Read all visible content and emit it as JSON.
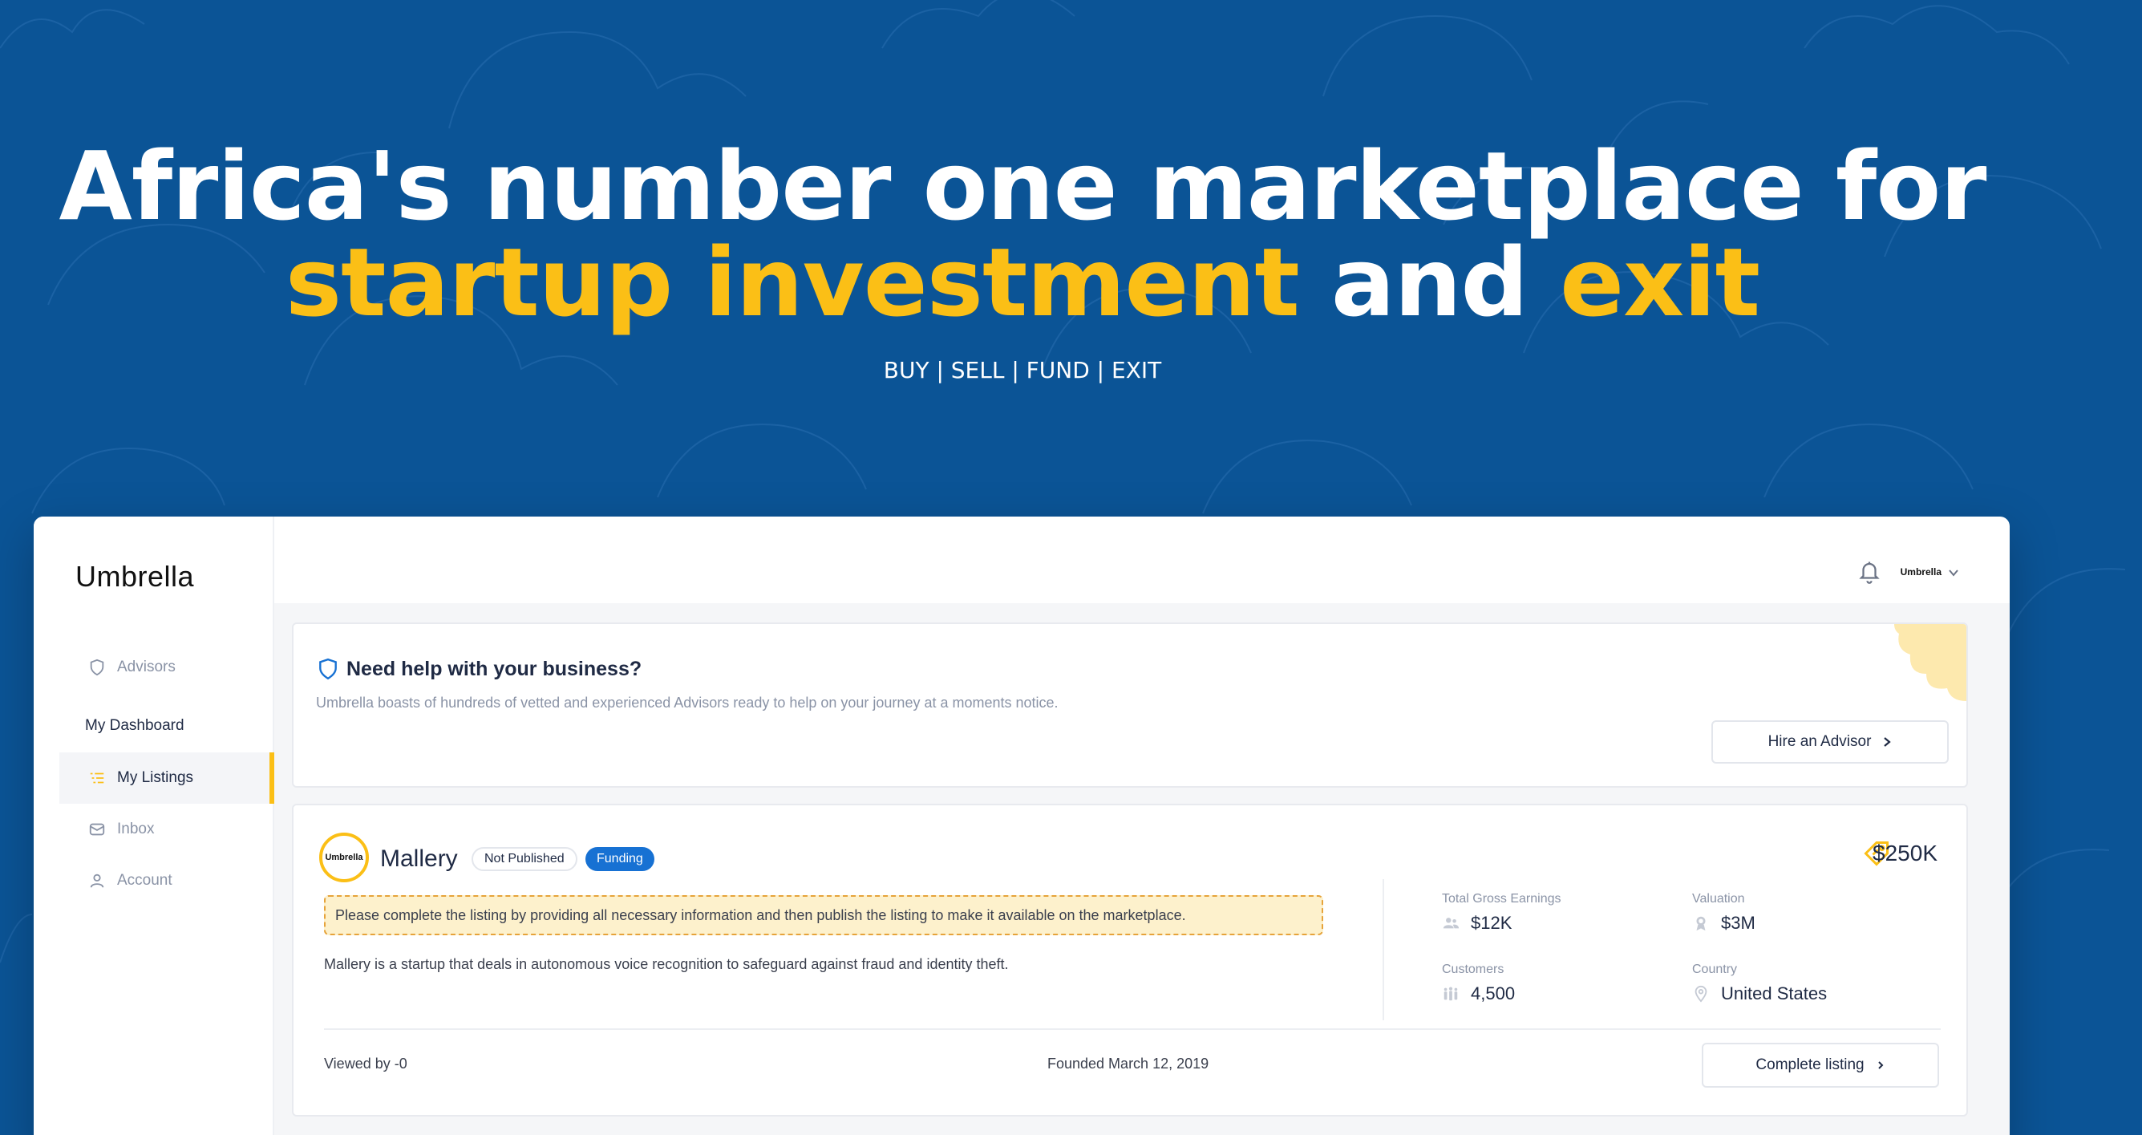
{
  "hero": {
    "line1": "Africa's number one marketplace for",
    "line2_part1": "startup investment",
    "line2_part2": " and ",
    "line2_part3": "exit",
    "tagline": "BUY | SELL | FUND | EXIT"
  },
  "colors": {
    "background": "#0b5496",
    "accent": "#fbbf16",
    "primary_badge": "#1771d3"
  },
  "brand": {
    "logo_text": "Umbrella",
    "mini_logo_text": "Umbrella"
  },
  "sidebar": {
    "advisors": "Advisors",
    "section_heading": "My Dashboard",
    "items": [
      {
        "label": "My Listings",
        "icon": "list-icon",
        "active": true
      },
      {
        "label": "Inbox",
        "icon": "mail-icon"
      },
      {
        "label": "Account",
        "icon": "user-icon"
      }
    ]
  },
  "help": {
    "title": "Need help with your business?",
    "description": "Umbrella boasts of hundreds of vetted and experienced Advisors ready to help on your journey at a moments notice.",
    "button": "Hire an Advisor"
  },
  "listing": {
    "logo_text": "Umbrella",
    "name": "Mallery",
    "status_badge": "Not Published",
    "type_badge": "Funding",
    "price": "$250K",
    "warning": "Please complete the listing by providing all necessary information and then publish the listing to make it available on the marketplace.",
    "description": "Mallery is a startup that deals in autonomous voice recognition to safeguard against fraud and identity theft.",
    "stats": {
      "earnings_label": "Total Gross Earnings",
      "earnings_value": "$12K",
      "valuation_label": "Valuation",
      "valuation_value": "$3M",
      "customers_label": "Customers",
      "customers_value": "4,500",
      "country_label": "Country",
      "country_value": "United States"
    },
    "viewed_by": "Viewed by -0",
    "founded": "Founded March 12, 2019",
    "complete_button": "Complete listing"
  }
}
